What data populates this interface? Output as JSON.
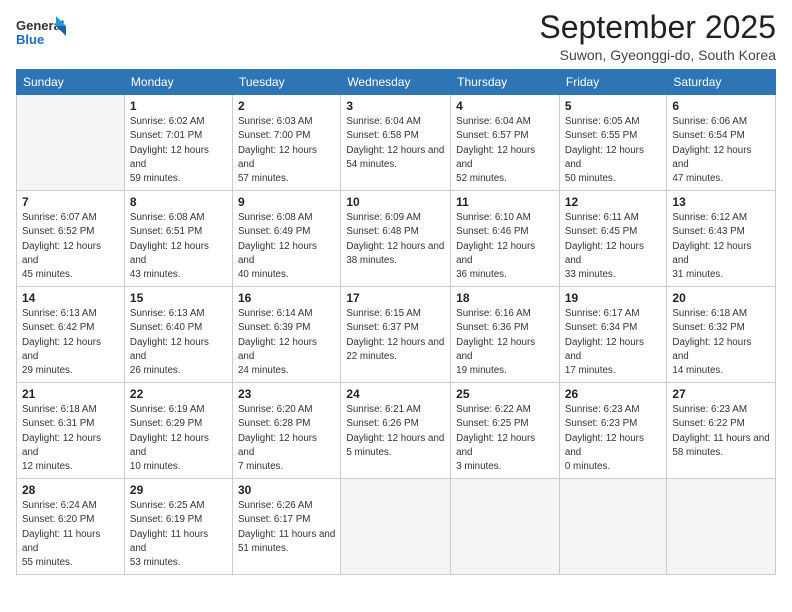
{
  "logo": {
    "line1": "General",
    "line2": "Blue"
  },
  "title": "September 2025",
  "subtitle": "Suwon, Gyeonggi-do, South Korea",
  "weekdays": [
    "Sunday",
    "Monday",
    "Tuesday",
    "Wednesday",
    "Thursday",
    "Friday",
    "Saturday"
  ],
  "weeks": [
    [
      {
        "day": "",
        "empty": true
      },
      {
        "day": "1",
        "sunrise": "6:02 AM",
        "sunset": "7:01 PM",
        "daylight": "12 hours and 59 minutes."
      },
      {
        "day": "2",
        "sunrise": "6:03 AM",
        "sunset": "7:00 PM",
        "daylight": "12 hours and 57 minutes."
      },
      {
        "day": "3",
        "sunrise": "6:04 AM",
        "sunset": "6:58 PM",
        "daylight": "12 hours and 54 minutes."
      },
      {
        "day": "4",
        "sunrise": "6:04 AM",
        "sunset": "6:57 PM",
        "daylight": "12 hours and 52 minutes."
      },
      {
        "day": "5",
        "sunrise": "6:05 AM",
        "sunset": "6:55 PM",
        "daylight": "12 hours and 50 minutes."
      },
      {
        "day": "6",
        "sunrise": "6:06 AM",
        "sunset": "6:54 PM",
        "daylight": "12 hours and 47 minutes."
      }
    ],
    [
      {
        "day": "7",
        "sunrise": "6:07 AM",
        "sunset": "6:52 PM",
        "daylight": "12 hours and 45 minutes."
      },
      {
        "day": "8",
        "sunrise": "6:08 AM",
        "sunset": "6:51 PM",
        "daylight": "12 hours and 43 minutes."
      },
      {
        "day": "9",
        "sunrise": "6:08 AM",
        "sunset": "6:49 PM",
        "daylight": "12 hours and 40 minutes."
      },
      {
        "day": "10",
        "sunrise": "6:09 AM",
        "sunset": "6:48 PM",
        "daylight": "12 hours and 38 minutes."
      },
      {
        "day": "11",
        "sunrise": "6:10 AM",
        "sunset": "6:46 PM",
        "daylight": "12 hours and 36 minutes."
      },
      {
        "day": "12",
        "sunrise": "6:11 AM",
        "sunset": "6:45 PM",
        "daylight": "12 hours and 33 minutes."
      },
      {
        "day": "13",
        "sunrise": "6:12 AM",
        "sunset": "6:43 PM",
        "daylight": "12 hours and 31 minutes."
      }
    ],
    [
      {
        "day": "14",
        "sunrise": "6:13 AM",
        "sunset": "6:42 PM",
        "daylight": "12 hours and 29 minutes."
      },
      {
        "day": "15",
        "sunrise": "6:13 AM",
        "sunset": "6:40 PM",
        "daylight": "12 hours and 26 minutes."
      },
      {
        "day": "16",
        "sunrise": "6:14 AM",
        "sunset": "6:39 PM",
        "daylight": "12 hours and 24 minutes."
      },
      {
        "day": "17",
        "sunrise": "6:15 AM",
        "sunset": "6:37 PM",
        "daylight": "12 hours and 22 minutes."
      },
      {
        "day": "18",
        "sunrise": "6:16 AM",
        "sunset": "6:36 PM",
        "daylight": "12 hours and 19 minutes."
      },
      {
        "day": "19",
        "sunrise": "6:17 AM",
        "sunset": "6:34 PM",
        "daylight": "12 hours and 17 minutes."
      },
      {
        "day": "20",
        "sunrise": "6:18 AM",
        "sunset": "6:32 PM",
        "daylight": "12 hours and 14 minutes."
      }
    ],
    [
      {
        "day": "21",
        "sunrise": "6:18 AM",
        "sunset": "6:31 PM",
        "daylight": "12 hours and 12 minutes."
      },
      {
        "day": "22",
        "sunrise": "6:19 AM",
        "sunset": "6:29 PM",
        "daylight": "12 hours and 10 minutes."
      },
      {
        "day": "23",
        "sunrise": "6:20 AM",
        "sunset": "6:28 PM",
        "daylight": "12 hours and 7 minutes."
      },
      {
        "day": "24",
        "sunrise": "6:21 AM",
        "sunset": "6:26 PM",
        "daylight": "12 hours and 5 minutes."
      },
      {
        "day": "25",
        "sunrise": "6:22 AM",
        "sunset": "6:25 PM",
        "daylight": "12 hours and 3 minutes."
      },
      {
        "day": "26",
        "sunrise": "6:23 AM",
        "sunset": "6:23 PM",
        "daylight": "12 hours and 0 minutes."
      },
      {
        "day": "27",
        "sunrise": "6:23 AM",
        "sunset": "6:22 PM",
        "daylight": "11 hours and 58 minutes."
      }
    ],
    [
      {
        "day": "28",
        "sunrise": "6:24 AM",
        "sunset": "6:20 PM",
        "daylight": "11 hours and 55 minutes."
      },
      {
        "day": "29",
        "sunrise": "6:25 AM",
        "sunset": "6:19 PM",
        "daylight": "11 hours and 53 minutes."
      },
      {
        "day": "30",
        "sunrise": "6:26 AM",
        "sunset": "6:17 PM",
        "daylight": "11 hours and 51 minutes."
      },
      {
        "day": "",
        "empty": true
      },
      {
        "day": "",
        "empty": true
      },
      {
        "day": "",
        "empty": true
      },
      {
        "day": "",
        "empty": true
      }
    ]
  ],
  "labels": {
    "sunrise_prefix": "Sunrise: ",
    "sunset_prefix": "Sunset: ",
    "daylight_prefix": "Daylight: "
  }
}
